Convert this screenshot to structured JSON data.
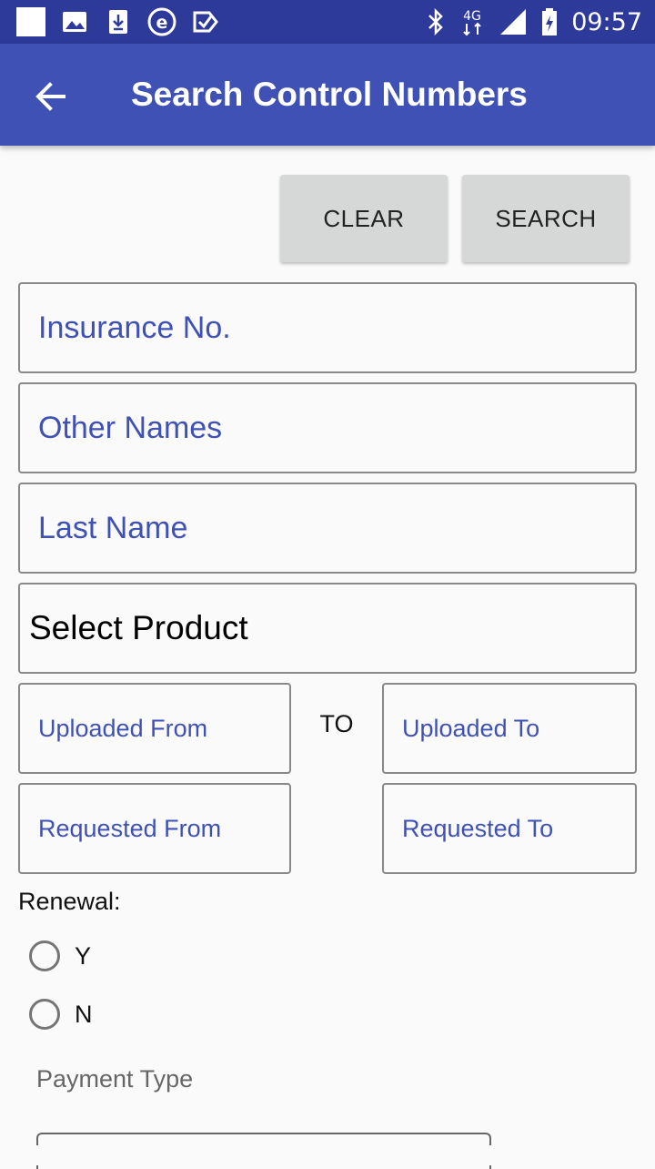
{
  "status_bar": {
    "time": "09:57",
    "network_label": "4G",
    "left_icons": [
      "notification-square-icon",
      "image-icon",
      "download-icon",
      "e-app-icon",
      "checkmark-app-icon"
    ],
    "right_icons": [
      "bluetooth-icon",
      "4g-data-icon",
      "signal-icon",
      "battery-icon"
    ]
  },
  "app_bar": {
    "title": "Search Control Numbers",
    "back_icon": "arrow-back-icon",
    "color": "#3f51b5"
  },
  "actions": {
    "clear_label": "CLEAR",
    "search_label": "SEARCH"
  },
  "form": {
    "insurance_no_placeholder": "Insurance No.",
    "other_names_placeholder": "Other Names",
    "last_name_placeholder": "Last Name",
    "product_select_value": "Select Product",
    "uploaded_from_placeholder": "Uploaded From",
    "to_label": "TO",
    "uploaded_to_placeholder": "Uploaded To",
    "requested_from_placeholder": "Requested From",
    "requested_to_placeholder": "Requested To",
    "renewal_label": "Renewal:",
    "renewal_options": [
      "Y",
      "N"
    ],
    "payment_type_label": "Payment Type"
  }
}
